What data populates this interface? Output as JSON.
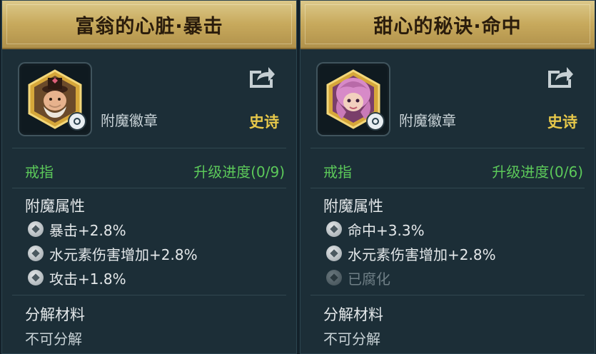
{
  "panels": [
    {
      "title": "富翁的心脏·暴击",
      "item_type": "附魔徽章",
      "rarity": "史诗",
      "slot": "戒指",
      "progress": "升级进度(0/9)",
      "attributes_label": "附魔属性",
      "attributes": [
        "暴击+2.8%",
        "水元素伤害增加+2.8%",
        "攻击+1.8%"
      ],
      "decompose_label": "分解材料",
      "decompose_value": "不可分解",
      "portrait_icon": "rich-old-man-portrait"
    },
    {
      "title": "甜心的秘诀·命中",
      "item_type": "附魔徽章",
      "rarity": "史诗",
      "slot": "戒指",
      "progress": "升级进度(0/6)",
      "attributes_label": "附魔属性",
      "attributes": [
        "命中+3.3%",
        "水元素伤害增加+2.8%",
        "已腐化"
      ],
      "decompose_label": "分解材料",
      "decompose_value": "不可分解",
      "portrait_icon": "pink-hair-girl-portrait"
    }
  ],
  "colors": {
    "header_gold": "#c7a95c",
    "panel_bg": "#1c2e37",
    "green": "#5cc95a",
    "epic_yellow": "#e7c84a",
    "corrupted_gray": "#6f7f86"
  }
}
